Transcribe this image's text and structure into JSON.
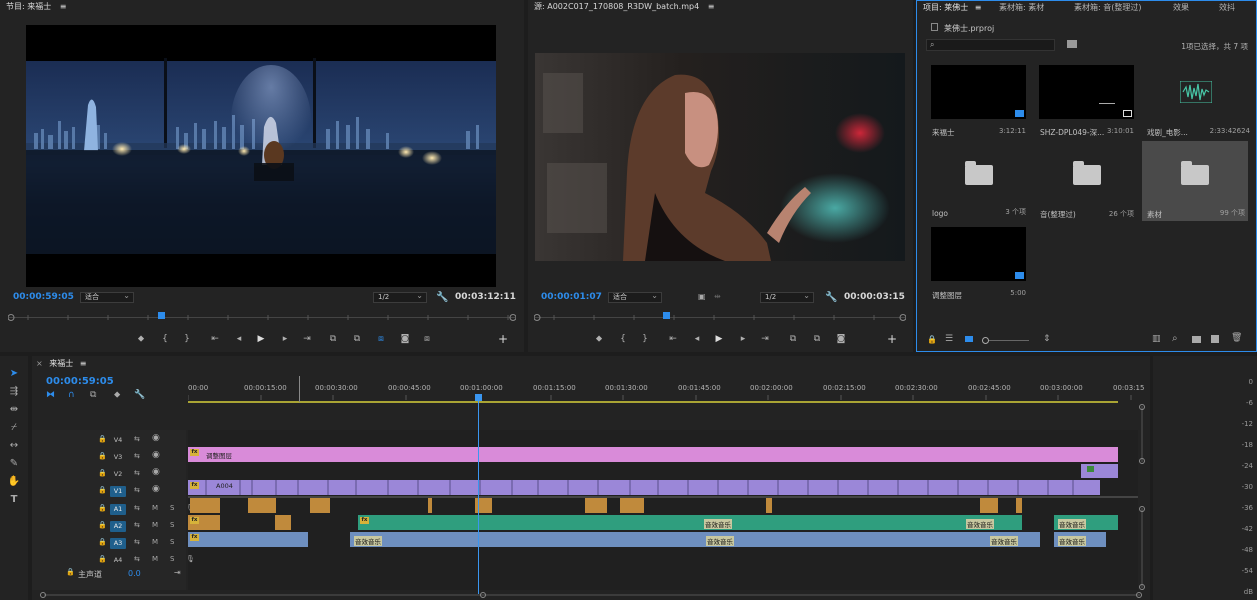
{
  "program_monitor": {
    "tab_label": "节目: 来福士",
    "menu_glyph": "≡",
    "current_time": "00:00:59:05",
    "fit_value": "适合",
    "resolution": "1/2",
    "duration": "00:03:12:11"
  },
  "source_monitor": {
    "tab_label": "源: A002C017_170808_R3DW_batch.mp4",
    "menu_glyph": "≡",
    "current_time": "00:00:01:07",
    "fit_value": "适合",
    "resolution": "1/2",
    "duration": "00:00:03:15"
  },
  "project_panel": {
    "tabs": [
      "项目: 莱佛士",
      "素材箱: 素材",
      "素材箱: 音(整理过)",
      "效果",
      "效抖"
    ],
    "tab_menu_glyph": "≡",
    "project_file": "莱佛士.prproj",
    "selection_status": "1项已选择，共 7 项",
    "items": [
      {
        "name": "来福士",
        "meta": "3:12:11",
        "kind": "sequence"
      },
      {
        "name": "SHZ-DPL049-深...",
        "meta": "3:10:01",
        "kind": "video"
      },
      {
        "name": "戏剧_电影...",
        "meta": "2:33:42624",
        "kind": "audio"
      },
      {
        "name": "logo",
        "meta": "3 个项",
        "kind": "folder"
      },
      {
        "name": "音(整理过)",
        "meta": "26 个项",
        "kind": "folder"
      },
      {
        "name": "素材",
        "meta": "99 个项",
        "kind": "folder",
        "selected": true
      },
      {
        "name": "调整图层",
        "meta": "5:00",
        "kind": "adjustment"
      }
    ]
  },
  "timeline": {
    "tab_label": "来福士",
    "close_glyph": "×",
    "menu_glyph": "≡",
    "current_time": "00:00:59:05",
    "ruler_labels": [
      "00:00",
      "00:00:15:00",
      "00:00:30:00",
      "00:00:45:00",
      "00:01:00:00",
      "00:01:15:00",
      "00:01:30:00",
      "00:01:45:00",
      "00:02:00:00",
      "00:02:15:00",
      "00:02:30:00",
      "00:02:45:00",
      "00:03:00:00",
      "00:03:15"
    ],
    "playhead_position": 0.308,
    "tracks": [
      {
        "id": "V4",
        "kind": "video"
      },
      {
        "id": "V3",
        "kind": "video"
      },
      {
        "id": "V2",
        "kind": "video"
      },
      {
        "id": "V1",
        "kind": "video",
        "targeted": true
      },
      {
        "id": "A1",
        "kind": "audio",
        "targeted": true
      },
      {
        "id": "A2",
        "kind": "audio",
        "targeted": true
      },
      {
        "id": "A3",
        "kind": "audio",
        "targeted": true
      },
      {
        "id": "A4",
        "kind": "audio"
      }
    ],
    "master": {
      "label": "主声道",
      "value": "0.0"
    },
    "adjustment_clip_label": "调整图层",
    "v1_first_clip_label": "A004",
    "audio_clip_label": "音效音乐",
    "button_labels": {
      "mute": "M",
      "solo": "S"
    }
  },
  "audio_meter": {
    "scale": [
      "0",
      "-6",
      "-12",
      "-18",
      "-24",
      "-30",
      "-36",
      "-42",
      "-48",
      "-54",
      "dB"
    ]
  },
  "colors": {
    "accent": "#2d8ceb",
    "playhead": "#3a96f0",
    "adjustment_clip": "#d98bd9",
    "video_clip": "#9b87d8",
    "audio_green": "#2f9e7e",
    "audio_blue": "#6e8fbf",
    "audio_orange": "#c08a3c"
  }
}
